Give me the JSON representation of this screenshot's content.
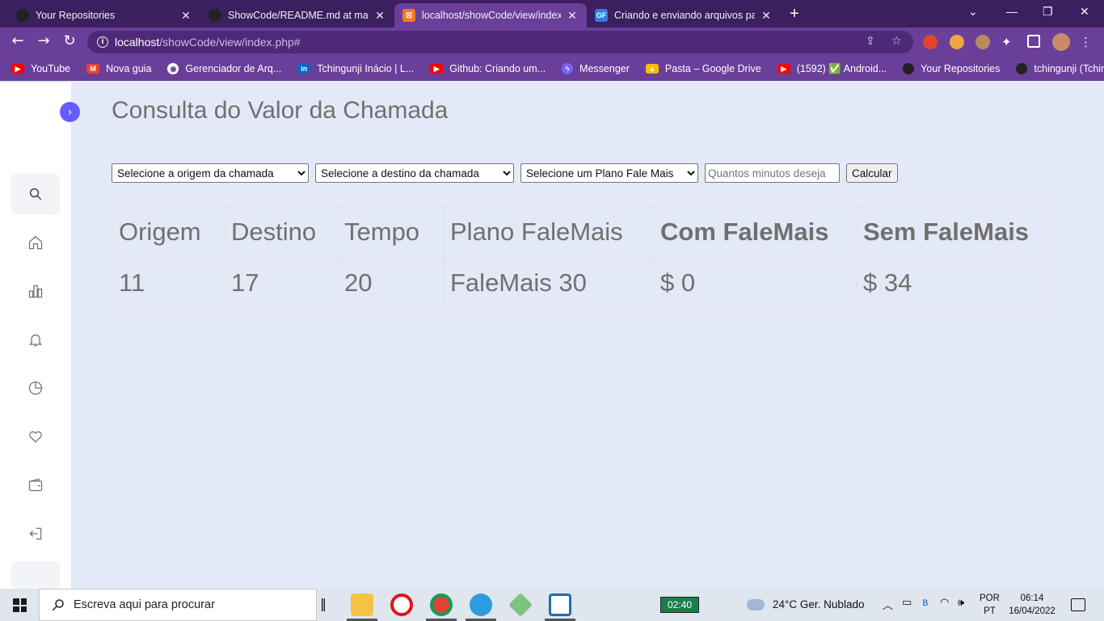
{
  "browser": {
    "tabs": [
      {
        "label": "Your Repositories",
        "icon": "github-icon"
      },
      {
        "label": "ShowCode/README.md at main",
        "icon": "github-icon"
      },
      {
        "label": "localhost/showCode/view/index.php#",
        "icon": "xampp-icon"
      },
      {
        "label": "Criando e enviando arquivos para",
        "icon": "gf-icon"
      }
    ],
    "url_host": "localhost",
    "url_path": "/showCode/view/index.php#",
    "bookmarks": [
      {
        "label": "YouTube",
        "icon": "youtube-icon",
        "color": "#ff0000"
      },
      {
        "label": "Nova guia",
        "icon": "gmail-icon",
        "color": "#ea4335"
      },
      {
        "label": "Gerenciador de Arq...",
        "icon": "globe-icon",
        "color": "#ffffff"
      },
      {
        "label": "Tchingunji Inácio | L...",
        "icon": "linkedin-icon",
        "color": "#0a66c2"
      },
      {
        "label": "Github: Criando um...",
        "icon": "youtube-icon",
        "color": "#ff0000"
      },
      {
        "label": "Messenger",
        "icon": "messenger-icon",
        "color": "#7b61ff"
      },
      {
        "label": "Pasta – Google Drive",
        "icon": "drive-icon",
        "color": "#fbbc04"
      },
      {
        "label": "(1592) ✅ Android...",
        "icon": "youtube-icon",
        "color": "#ff0000"
      },
      {
        "label": "Your Repositories",
        "icon": "github-icon",
        "color": "#222222"
      },
      {
        "label": "tchingunji (Tchingu...",
        "icon": "github-icon",
        "color": "#222222"
      }
    ]
  },
  "page": {
    "title": "Consulta do Valor da Chamada",
    "form": {
      "origem_select": "Selecione a origem da chamada",
      "destino_select": "Selecione a destino da chamada",
      "plano_select": "Selecione um Plano Fale Mais",
      "minutos_placeholder": "Quantos minutos deseja",
      "calcular_label": "Calcular"
    },
    "table": {
      "headers": [
        "Origem",
        "Destino",
        "Tempo",
        "Plano FaleMais",
        "Com FaleMais",
        "Sem FaleMais"
      ],
      "row": [
        "11",
        "17",
        "20",
        "FaleMais 30",
        "$ 0",
        "$ 34"
      ]
    },
    "accent_color": "#695cfe"
  },
  "taskbar": {
    "search_placeholder": "Escreva aqui para procurar",
    "widget_time": "02:40",
    "weather": "24°C  Ger. Nublado",
    "lang_top": "POR",
    "lang_bottom": "PT",
    "clock_time": "06:14",
    "clock_date": "16/04/2022"
  }
}
